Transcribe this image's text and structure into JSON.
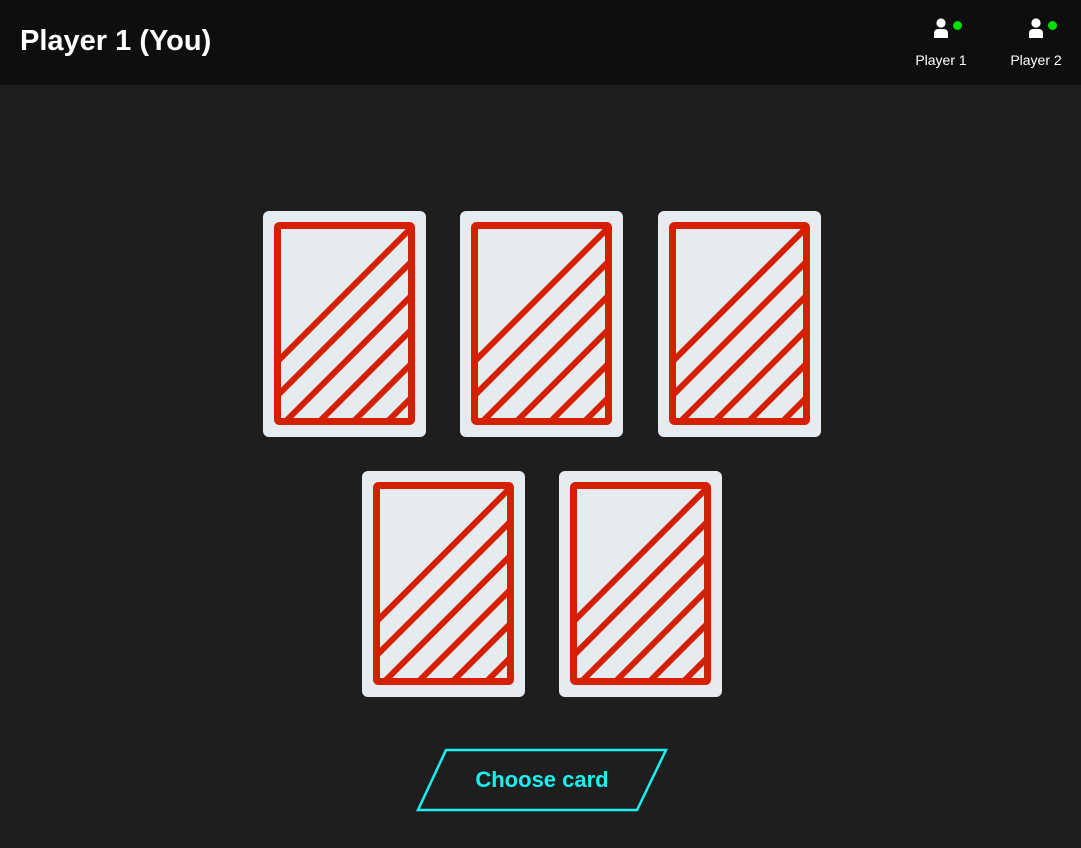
{
  "header": {
    "title": "Player 1 (You)"
  },
  "players": [
    {
      "name": "Player 1",
      "icon": "user-icon",
      "status": "online",
      "status_color": "#00e000"
    },
    {
      "name": "Player 2",
      "icon": "user-icon",
      "status": "online",
      "status_color": "#00e000"
    }
  ],
  "hand": {
    "card_count": 5,
    "card_face": "face-down",
    "card_back_color": "#e6ebf0",
    "card_pattern_color": "#d42000"
  },
  "actions": {
    "choose_label": "Choose card"
  },
  "colors": {
    "background": "#1e1e1e",
    "header": "#0e0e0e",
    "accent": "#19f0f0"
  }
}
